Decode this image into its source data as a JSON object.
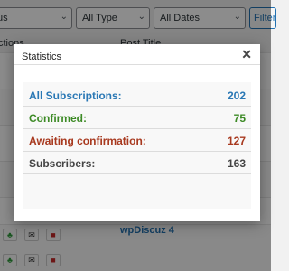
{
  "filters": {
    "status_partial": "us",
    "type": "All Type",
    "dates": "All Dates",
    "filter_partial": "Filter"
  },
  "columns": {
    "actions_partial": "ctions",
    "post_title": "Post Title"
  },
  "background_rows": {
    "last_post_title": "wpDiscuz 4"
  },
  "modal": {
    "title": "Statistics",
    "close_glyph": "✕",
    "stats": [
      {
        "label": "All Subscriptions:",
        "value": "202",
        "color": "#2a78b5"
      },
      {
        "label": "Confirmed:",
        "value": "75",
        "color": "#3c8a25"
      },
      {
        "label": "Awaiting confirmation:",
        "value": "127",
        "color": "#a8391f"
      },
      {
        "label": "Subscribers:",
        "value": "163",
        "color": "#444444"
      }
    ]
  },
  "icons": {
    "ok": "♣",
    "mail": "✉",
    "del": "■",
    "warn": "✗",
    "chevron": "⌄"
  }
}
